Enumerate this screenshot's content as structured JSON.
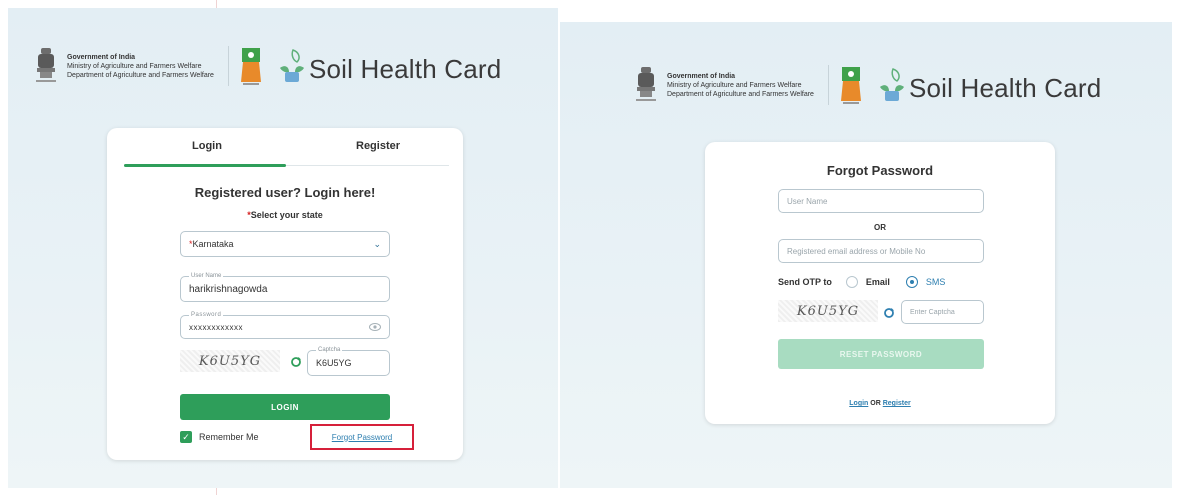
{
  "header": {
    "gov_line1": "Government of India",
    "gov_line2": "Ministry of Agriculture and Farmers Welfare",
    "gov_line3": "Department of Agriculture and Farmers Welfare",
    "app_name": "Soil Health Card"
  },
  "login_card": {
    "tab_login": "Login",
    "tab_register": "Register",
    "heading": "Registered user? Login here!",
    "state_label_req": "*",
    "state_label": "Select your state",
    "state_value_req": "*",
    "state_value": "Karnataka",
    "username_label": "User Name",
    "username_value": "harikrishnagowda",
    "password_label": "Password",
    "password_value": "xxxxxxxxxxxx",
    "captcha_text": "K6U5YG",
    "captcha_label": "Captcha",
    "captcha_value": "K6U5YG",
    "login_button": "LOGIN",
    "remember_me": "Remember Me",
    "forgot_password": "Forgot Password"
  },
  "forgot_card": {
    "heading": "Forgot Password",
    "username_placeholder": "User Name",
    "or_text": "OR",
    "email_placeholder": "Registered email address or Mobile No",
    "send_otp_label": "Send OTP to",
    "option_email": "Email",
    "option_sms": "SMS",
    "selected_option": "SMS",
    "captcha_text": "K6U5YG",
    "captcha_placeholder": "Enter Captcha",
    "reset_button": "RESET PASSWORD",
    "link_login": "Login",
    "link_or": " OR ",
    "link_register": "Register"
  },
  "colors": {
    "accent_green": "#2e9e5a",
    "link_blue": "#2e7fb0",
    "highlight_red": "#d6203a",
    "disabled_green": "#a8dcc1"
  }
}
